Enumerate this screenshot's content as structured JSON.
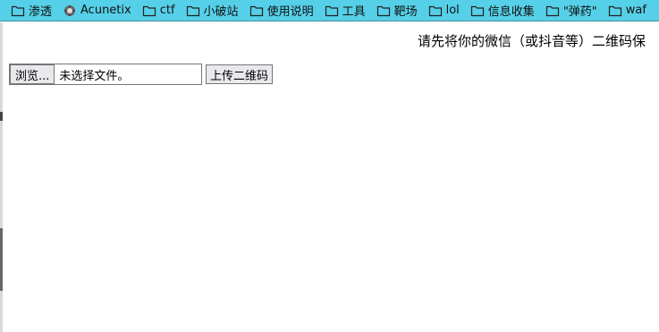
{
  "bookmarks": [
    {
      "label": "渗透",
      "icon": "folder-icon"
    },
    {
      "label": "Acunetix",
      "icon": "acunetix-icon"
    },
    {
      "label": "ctf",
      "icon": "folder-icon"
    },
    {
      "label": "小破站",
      "icon": "folder-icon"
    },
    {
      "label": "使用说明",
      "icon": "folder-icon"
    },
    {
      "label": "工具",
      "icon": "folder-icon"
    },
    {
      "label": "靶场",
      "icon": "folder-icon"
    },
    {
      "label": "lol",
      "icon": "folder-icon"
    },
    {
      "label": "信息收集",
      "icon": "folder-icon"
    },
    {
      "label": "\"弹药\"",
      "icon": "folder-icon"
    },
    {
      "label": "waf",
      "icon": "folder-icon"
    }
  ],
  "page": {
    "notice": "请先将你的微信（或抖音等）二维码保",
    "browse_label": "浏览...",
    "no_file_label": "未选择文件。",
    "upload_label": "上传二维码"
  },
  "colors": {
    "bookmarks_bar": "#56d0e8",
    "page_background": "#ffffff"
  }
}
